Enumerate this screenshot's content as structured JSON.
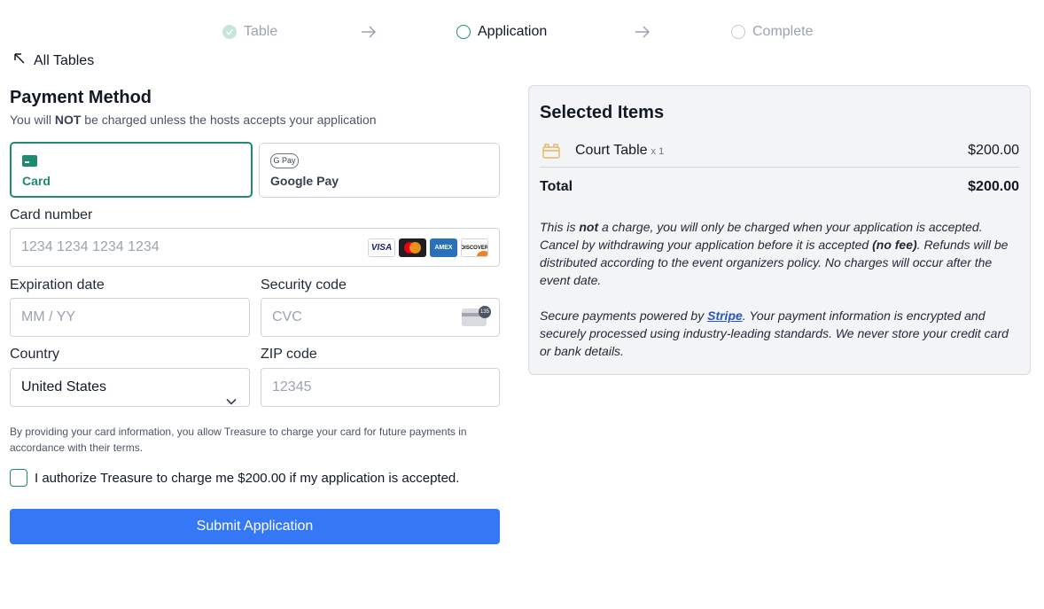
{
  "stepper": {
    "steps": [
      {
        "label": "Table",
        "state": "done"
      },
      {
        "label": "Application",
        "state": "active"
      },
      {
        "label": "Complete",
        "state": "todo"
      }
    ]
  },
  "nav": {
    "back_label": "All Tables"
  },
  "payment": {
    "title": "Payment Method",
    "subtitle_pre": "You will ",
    "subtitle_bold": "NOT",
    "subtitle_post": " be charged unless the hosts accepts your application",
    "methods": [
      {
        "label": "Card",
        "selected": true,
        "icon": "card-icon"
      },
      {
        "label": "Google Pay",
        "selected": false,
        "icon": "google-pay-icon",
        "badge": "G Pay"
      }
    ],
    "card_number": {
      "label": "Card number",
      "placeholder": "1234 1234 1234 1234",
      "brands": [
        "VISA",
        "Mastercard",
        "AMEX",
        "DISCOVER"
      ]
    },
    "expiration": {
      "label": "Expiration date",
      "placeholder": "MM / YY"
    },
    "security": {
      "label": "Security code",
      "placeholder": "CVC",
      "badge": "135"
    },
    "country": {
      "label": "Country",
      "value": "United States"
    },
    "zip": {
      "label": "ZIP code",
      "placeholder": "12345"
    },
    "consent": "By providing your card information, you allow Treasure to charge your card for future payments in accordance with their terms.",
    "authorize": "I authorize Treasure to charge me $200.00 if my application is accepted.",
    "submit_label": "Submit Application"
  },
  "summary": {
    "title": "Selected Items",
    "items": [
      {
        "name": "Court Table",
        "qty": "x 1",
        "price": "$200.00"
      }
    ],
    "total_label": "Total",
    "total_value": "$200.00",
    "note1_a": "This is ",
    "note1_b": "not",
    "note1_c": " a charge, you will only be charged when your application is accepted. Cancel by withdrawing your application before it is accepted ",
    "note1_d": "(no fee)",
    "note1_e": ". Refunds will be distributed according to the event organizers policy. No charges will occur after the event date.",
    "note2_a": "Secure payments powered by ",
    "note2_link": "Stripe",
    "note2_b": ". Your payment information is encrypted and securely processed using industry-leading standards. We never store your credit card or bank details."
  },
  "colors": {
    "accent": "#1f8a70",
    "primary_button": "#3478f6",
    "link": "#2556c4"
  }
}
